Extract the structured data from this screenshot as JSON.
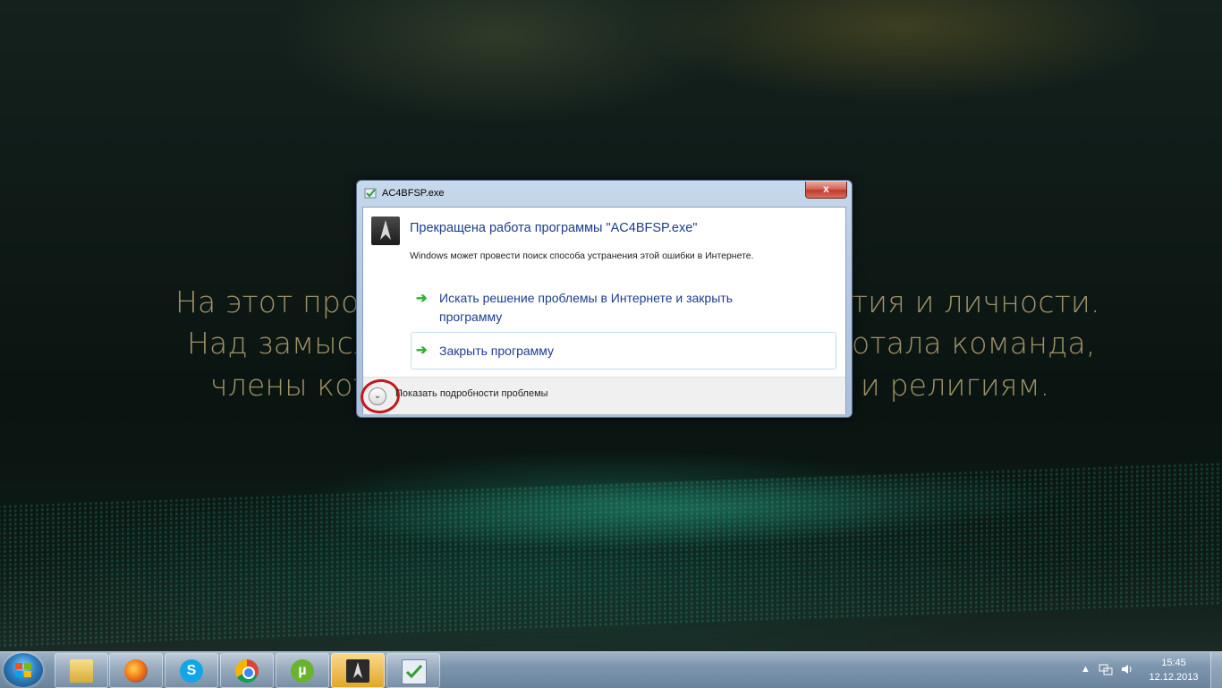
{
  "desktop": {
    "bg_lines": [
      {
        "left": "На этот проек",
        "right": "тия и личности."
      },
      {
        "left": "Над замысло",
        "right": "отала команда,"
      },
      {
        "left": "члены кото",
        "right": "и религиям."
      }
    ]
  },
  "dialog": {
    "title": "AC4BFSP.exe",
    "close_glyph": "x",
    "heading": "Прекращена работа программы \"AC4BFSP.exe\"",
    "subtext": "Windows может провести поиск способа устранения этой ошибки в Интернете.",
    "commands": [
      {
        "label": "Искать решение проблемы в Интернете и закрыть программу"
      },
      {
        "label": "Закрыть программу"
      }
    ],
    "details_label": "Показать подробности проблемы",
    "arrow_glyph": "➔",
    "chevron_glyph": "⌄"
  },
  "taskbar": {
    "pinned": [
      "windows-explorer",
      "firefox",
      "skype",
      "chrome",
      "utorrent",
      "ac4bfsp",
      "problem-reporting"
    ],
    "time": "15:45",
    "date": "12.12.2013",
    "tray_arrow": "▲",
    "colors": {
      "active": "#e4a62a"
    }
  }
}
